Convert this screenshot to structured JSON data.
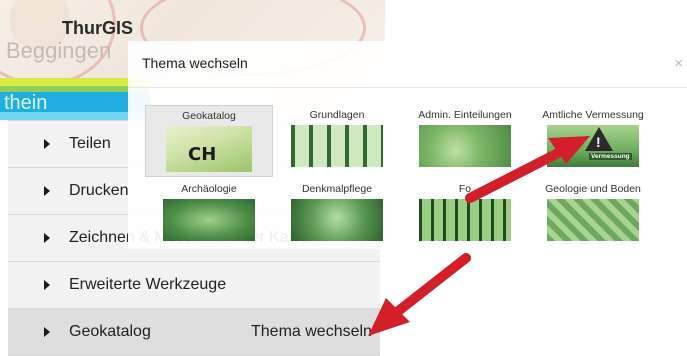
{
  "app": {
    "title": "ThurGIS",
    "map_town": "Beggingen",
    "stripe_text": "thein"
  },
  "sidebar": {
    "items": [
      {
        "label": "Teilen"
      },
      {
        "label": "Drucken"
      },
      {
        "label": "Zeichnen & Messen auf der Karte"
      },
      {
        "label": "Erweiterte Werkzeuge"
      },
      {
        "label": "Geokatalog",
        "right_label": "Thema wechseln",
        "active": true
      }
    ]
  },
  "modal": {
    "title": "Thema wechseln",
    "close_glyph": "×",
    "tiles": [
      {
        "label": "Geokatalog",
        "icon": "book-ch-icon",
        "selected": true,
        "overlay": "CH"
      },
      {
        "label": "Grundlagen",
        "icon": "documents-icon"
      },
      {
        "label": "Admin. Einteilungen",
        "icon": "boundary-stone-icon"
      },
      {
        "label": "Amtliche Vermessung",
        "icon": "warning-sign-icon",
        "overlay": "Vermessung"
      },
      {
        "label": "Archäologie",
        "icon": "relief-icon"
      },
      {
        "label": "Denkmalpflege",
        "icon": "ornament-icon"
      },
      {
        "label": "Fo",
        "icon": "forest-icon"
      },
      {
        "label": "Geologie und Boden",
        "icon": "cracked-soil-icon"
      }
    ]
  },
  "colors": {
    "arrow": "#d31f2a",
    "stripe_blue": "#20aee0",
    "thumbnail_green": "#4d8a45"
  }
}
